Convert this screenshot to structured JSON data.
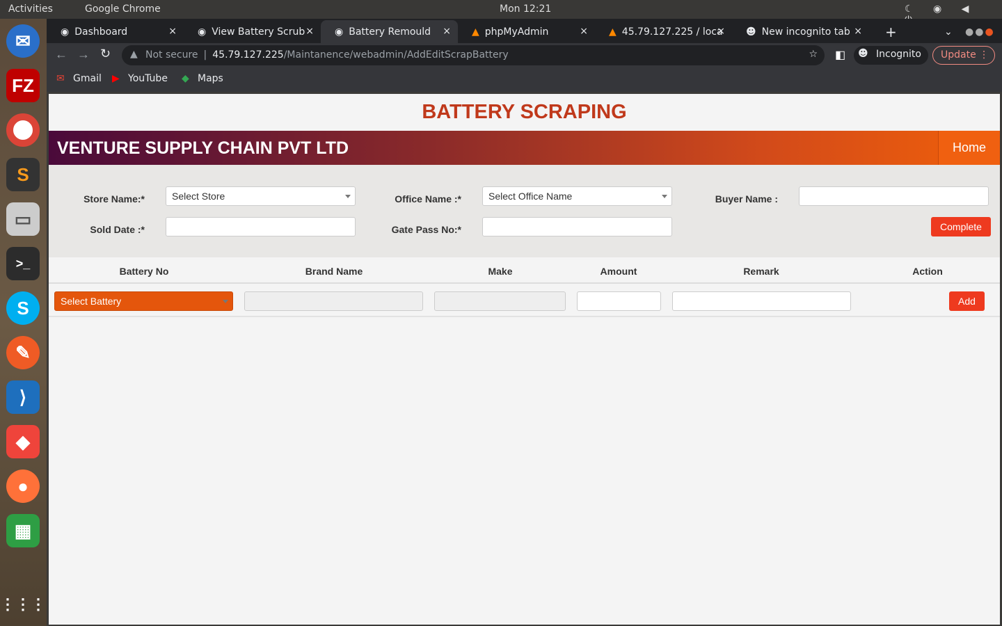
{
  "system": {
    "activities": "Activities",
    "app_menu": "Google Chrome",
    "clock": "Mon 12:21"
  },
  "browser": {
    "tabs": [
      {
        "label": "Dashboard"
      },
      {
        "label": "View Battery Scrub"
      },
      {
        "label": "Battery Remould"
      },
      {
        "label": "phpMyAdmin"
      },
      {
        "label": "45.79.127.225 / loca"
      },
      {
        "label": "New incognito tab"
      }
    ],
    "security": "Not secure",
    "url_host": "45.79.127.225",
    "url_path": "/Maintanence/webadmin/AddEditScrapBattery",
    "incognito": "Incognito",
    "update": "Update",
    "bookmarks": [
      {
        "label": "Gmail"
      },
      {
        "label": "YouTube"
      },
      {
        "label": "Maps"
      }
    ]
  },
  "page": {
    "title": "BATTERY SCRAPING",
    "company": "VENTURE SUPPLY CHAIN PVT LTD",
    "home": "Home",
    "form": {
      "store_label": "Store Name:*",
      "store_value": "Select Store",
      "office_label": "Office Name :*",
      "office_value": "Select Office Name",
      "buyer_label": "Buyer Name :",
      "sold_label": "Sold Date :*",
      "gate_label": "Gate Pass No:*",
      "complete": "Complete"
    },
    "table": {
      "headers": [
        "Battery No",
        "Brand Name",
        "Make",
        "Amount",
        "Remark",
        "Action"
      ],
      "battery_select": "Select Battery",
      "add": "Add"
    }
  },
  "colors": {
    "accent": "#e85a0e",
    "title": "#c0391b",
    "button": "#ee3a1f"
  }
}
